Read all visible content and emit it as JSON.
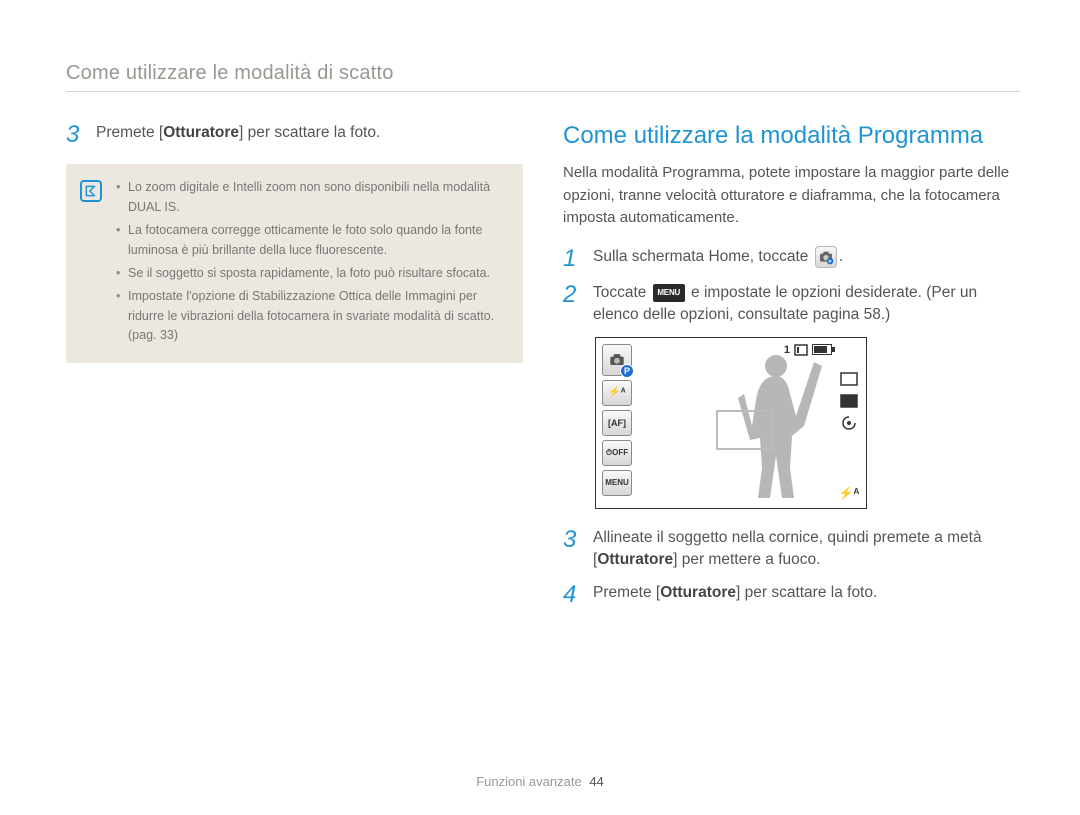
{
  "header": "Come utilizzare le modalità di scatto",
  "left": {
    "step3": {
      "num": "3",
      "pre": "Premete [",
      "bold": "Otturatore",
      "post": "] per scattare la foto."
    },
    "notes": [
      "Lo zoom digitale e Intelli zoom non sono disponibili nella modalità DUAL IS.",
      "La fotocamera corregge otticamente le foto solo quando la fonte luminosa è più brillante della luce fluorescente.",
      "Se il soggetto si sposta rapidamente, la foto può risultare sfocata.",
      "Impostate l'opzione di Stabilizzazione Ottica delle Immagini per ridurre le vibrazioni della fotocamera in svariate modalità di scatto. (pag. 33)"
    ]
  },
  "right": {
    "title": "Come utilizzare la modalità Programma",
    "intro": "Nella modalità Programma, potete impostare la maggior parte delle opzioni, tranne velocità otturatore e diaframma, che la fotocamera imposta automaticamente.",
    "step1": {
      "num": "1",
      "text": "Sulla schermata Home, toccate",
      "icon_name": "program-mode-icon",
      "trail": "."
    },
    "step2": {
      "num": "2",
      "pre": "Toccate ",
      "menu_label": "MENU",
      "mid": " e impostate le opzioni desiderate. (Per un elenco delle opzioni, consultate pagina 58.)"
    },
    "step3": {
      "num": "3",
      "pre": "Allineate il soggetto nella cornice, quindi premete a metà [",
      "bold": "Otturatore",
      "post": "] per mettere a fuoco."
    },
    "step4": {
      "num": "4",
      "pre": "Premete [",
      "bold": "Otturatore",
      "post": "] per scattare la foto."
    }
  },
  "screen": {
    "counter": "1",
    "mode_badge": "P",
    "left_icons": [
      "mode-p-icon",
      "flash-auto-icon",
      "af-icon",
      "timer-off-icon",
      "menu-icon"
    ],
    "left_labels": {
      "flash": "⚡ᴬ",
      "af": "[AF]",
      "timer": "⏱OFF",
      "menu": "MENU"
    },
    "right_icons": [
      "size-icon",
      "quality-icon",
      "ois-icon"
    ],
    "bottom_right": "⚡ᴬ"
  },
  "footer": {
    "section": "Funzioni avanzate",
    "page": "44"
  }
}
